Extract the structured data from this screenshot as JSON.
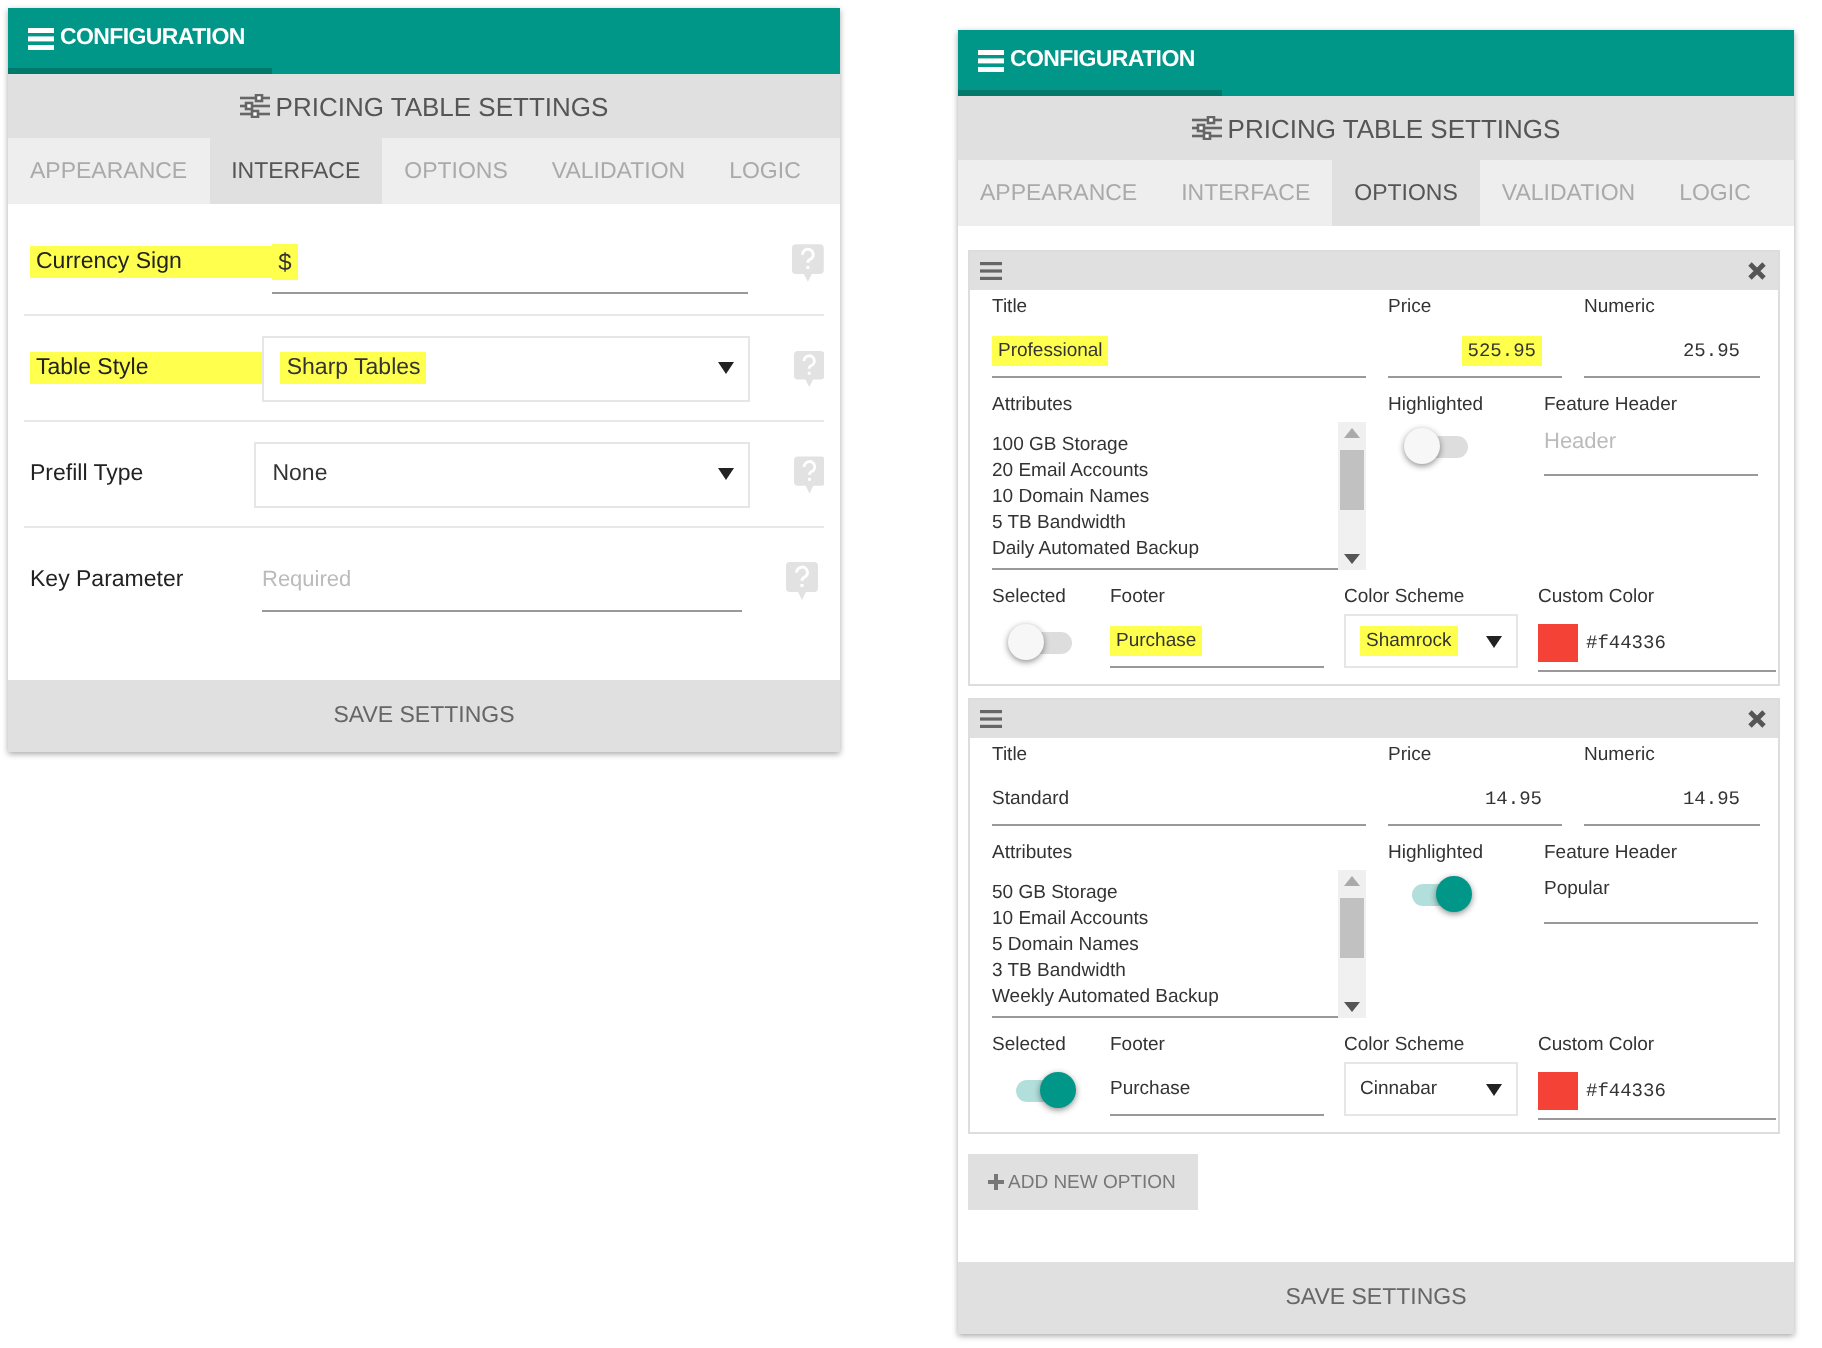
{
  "left_panel": {
    "header": "CONFIGURATION",
    "subheader": "PRICING TABLE SETTINGS",
    "tabs": [
      {
        "label": "APPEARANCE",
        "selected": false
      },
      {
        "label": "INTERFACE",
        "selected": true
      },
      {
        "label": "OPTIONS",
        "selected": false
      },
      {
        "label": "VALIDATION",
        "selected": false
      },
      {
        "label": "LOGIC",
        "selected": false
      }
    ],
    "fields": [
      {
        "kind": "text",
        "label": "Currency Sign",
        "value": "$",
        "marked": true
      },
      {
        "kind": "select",
        "label": "Table Style",
        "value": "Sharp Tables",
        "marked": true
      },
      {
        "kind": "select",
        "label": "Prefill Type",
        "value": "None",
        "marked": false
      },
      {
        "kind": "text",
        "label": "Key Parameter",
        "placeholder": "Required",
        "marked": false
      }
    ],
    "save_button": "SAVE SETTINGS"
  },
  "right_panel": {
    "header": "CONFIGURATION",
    "subheader": "PRICING TABLE SETTINGS",
    "tabs": [
      {
        "label": "APPEARANCE",
        "selected": false
      },
      {
        "label": "INTERFACE",
        "selected": false
      },
      {
        "label": "OPTIONS",
        "selected": true
      },
      {
        "label": "VALIDATION",
        "selected": false
      },
      {
        "label": "LOGIC",
        "selected": false
      }
    ],
    "options": [
      {
        "title": {
          "label": "Title",
          "value": "Professional",
          "marked": true
        },
        "price": {
          "label": "Price",
          "value": "525.95",
          "marked": true
        },
        "numeric": {
          "label": "Numeric",
          "value": "25.95",
          "marked": false
        },
        "attributes": {
          "label": "Attributes",
          "lines": [
            "100 GB Storage",
            "20 Email Accounts",
            "10 Domain Names",
            "5 TB Bandwidth",
            "Daily Automated Backup"
          ]
        },
        "highlighted": {
          "label": "Highlighted",
          "on": false
        },
        "feature_header": {
          "label": "Feature Header",
          "placeholder": "Header"
        },
        "selected_toggle": {
          "label": "Selected",
          "on": false
        },
        "footer": {
          "label": "Footer",
          "value": "Purchase",
          "marked": true
        },
        "color_scheme": {
          "label": "Color Scheme",
          "value": "Shamrock",
          "marked": true
        },
        "custom_color": {
          "label": "Custom Color",
          "value": "#f44336",
          "color": "#f44336"
        }
      },
      {
        "title": {
          "label": "Title",
          "value": "Standard",
          "marked": false
        },
        "price": {
          "label": "Price",
          "value": "14.95",
          "marked": false
        },
        "numeric": {
          "label": "Numeric",
          "value": "14.95",
          "marked": false
        },
        "attributes": {
          "label": "Attributes",
          "lines": [
            "50 GB Storage",
            "10 Email Accounts",
            "5 Domain Names",
            "3 TB Bandwidth",
            "Weekly Automated Backup"
          ]
        },
        "highlighted": {
          "label": "Highlighted",
          "on": true
        },
        "feature_header": {
          "label": "Feature Header",
          "value": "Popular"
        },
        "selected_toggle": {
          "label": "Selected",
          "on": true
        },
        "footer": {
          "label": "Footer",
          "value": "Purchase",
          "marked": false
        },
        "color_scheme": {
          "label": "Color Scheme",
          "value": "Cinnabar",
          "marked": false
        },
        "custom_color": {
          "label": "Custom Color",
          "value": "#f44336",
          "color": "#f44336"
        }
      }
    ],
    "add_button": "ADD NEW OPTION",
    "save_button": "SAVE SETTINGS"
  }
}
